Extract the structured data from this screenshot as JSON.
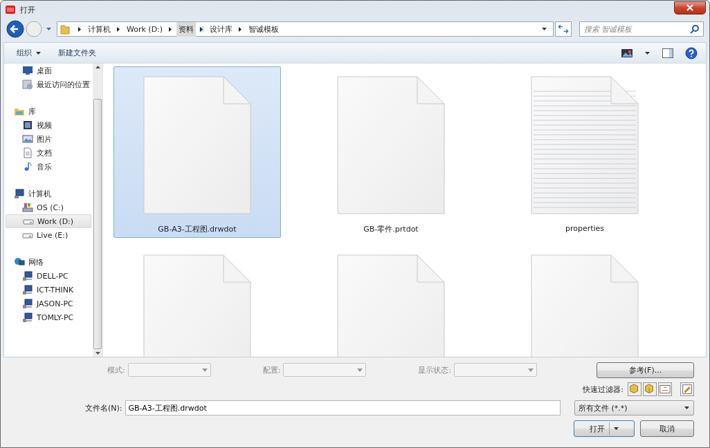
{
  "window": {
    "title": "打开"
  },
  "address_bar": {
    "crumbs": [
      {
        "label": "计算机",
        "selected": false
      },
      {
        "label": "Work (D:)",
        "selected": false
      },
      {
        "label": "资料",
        "selected": true
      },
      {
        "label": "设计库",
        "selected": false
      },
      {
        "label": "智诚模板",
        "selected": false
      }
    ]
  },
  "search": {
    "placeholder": "搜索 智诚模板"
  },
  "toolbar": {
    "buttons": [
      {
        "label": "组织",
        "kind": "menu"
      },
      {
        "label": "新建文件夹",
        "kind": "plain"
      }
    ]
  },
  "sidebar": {
    "groups": [
      {
        "children": [
          {
            "label": "桌面",
            "kind": "desktop",
            "selected": false
          },
          {
            "label": "最近访问的位置",
            "kind": "recent",
            "selected": false
          }
        ]
      },
      {
        "label": "库",
        "kind": "library",
        "children": [
          {
            "label": "视频",
            "kind": "video",
            "selected": false
          },
          {
            "label": "图片",
            "kind": "picture",
            "selected": false
          },
          {
            "label": "文档",
            "kind": "document",
            "selected": false
          },
          {
            "label": "音乐",
            "kind": "music",
            "selected": false
          }
        ]
      },
      {
        "label": "计算机",
        "kind": "computer",
        "children": [
          {
            "label": "OS (C:)",
            "kind": "osdrive",
            "selected": false
          },
          {
            "label": "Work (D:)",
            "kind": "drive",
            "selected": true
          },
          {
            "label": "Live (E:)",
            "kind": "drive",
            "selected": false
          }
        ]
      },
      {
        "label": "网络",
        "kind": "network",
        "children": [
          {
            "label": "DELL-PC",
            "kind": "pc",
            "selected": false
          },
          {
            "label": "ICT-THINK",
            "kind": "pc",
            "selected": false
          },
          {
            "label": "JASON-PC",
            "kind": "pc",
            "selected": false
          },
          {
            "label": "TOMLY-PC",
            "kind": "pc",
            "selected": false
          }
        ]
      }
    ]
  },
  "files": [
    {
      "name": "GB-A3-工程图.drwdot",
      "kind": "blank",
      "selected": true
    },
    {
      "name": "GB-零件.prtdot",
      "kind": "blank",
      "selected": false
    },
    {
      "name": "properties",
      "kind": "lined",
      "selected": false
    },
    {
      "kind": "blank",
      "selected": false
    },
    {
      "kind": "blank",
      "selected": false
    },
    {
      "kind": "blank",
      "selected": false
    }
  ],
  "options": [
    {
      "label": "模式:",
      "disabled": true
    },
    {
      "label": "配置:",
      "disabled": true
    },
    {
      "label": "显示状态:",
      "disabled": true
    }
  ],
  "reference_button": "参考(F)...",
  "quick_filter": {
    "label": "快速过滤器:"
  },
  "file_name": {
    "label": "文件名(N):",
    "value": "GB-A3-工程图.drwdot"
  },
  "file_type": {
    "value": "所有文件 (*.*)"
  },
  "buttons": [
    {
      "label": "打开",
      "kind": "split"
    },
    {
      "label": "取消",
      "kind": "plain"
    }
  ]
}
